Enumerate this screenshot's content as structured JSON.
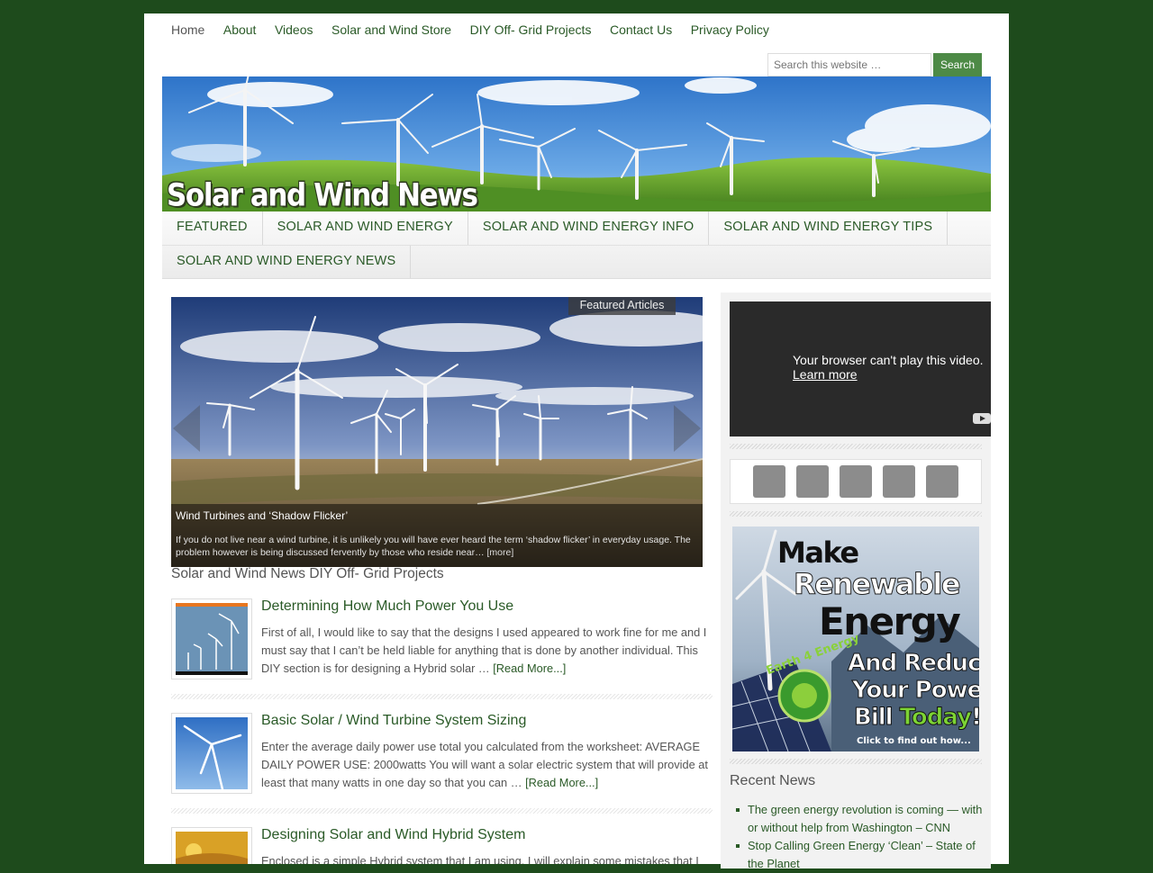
{
  "top_nav": [
    "Home",
    "About",
    "Videos",
    "Solar and Wind Store",
    "DIY Off- Grid Projects",
    "Contact Us",
    "Privacy Policy"
  ],
  "search": {
    "placeholder": "Search this website …",
    "button": "Search"
  },
  "site_title": "Solar and Wind News",
  "category_nav": {
    "row1": [
      "FEATURED",
      "SOLAR AND WIND ENERGY",
      "SOLAR AND WIND ENERGY INFO",
      "SOLAR AND WIND ENERGY TIPS"
    ],
    "row2": [
      "SOLAR AND WIND ENERGY NEWS"
    ]
  },
  "slider": {
    "tag": "Featured Articles",
    "title": "Wind Turbines and ‘Shadow Flicker’",
    "excerpt": "If you do not live near a wind turbine, it is unlikely you will have ever heard the term ‘shadow flicker’ in everyday usage. The problem however is being discussed fervently by those who reside near…",
    "more": "[more]"
  },
  "section_title": "Solar and Wind News DIY Off- Grid Projects",
  "posts": [
    {
      "title": "Determining How Much Power You Use",
      "excerpt": "First of all, I would like to say that the designs I used appeared to work fine for me and I must say that I can’t be held liable for anything that is done by another individual. This DIY section is for designing a Hybrid solar …",
      "read_more": "[Read More...]"
    },
    {
      "title": "Basic Solar / Wind Turbine System Sizing",
      "excerpt": "Enter the average daily power use total you calculated from the worksheet: AVERAGE DAILY POWER USE:   2000watts You will want a solar electric system that will provide at least that many watts in one day so that you can …",
      "read_more": "[Read More...]"
    },
    {
      "title": "Designing Solar and Wind Hybrid System",
      "excerpt": "Enclosed is a simple Hybrid system that I am using. I will explain some mistakes that I",
      "read_more": ""
    }
  ],
  "video": {
    "message": "Your browser can't play this video.",
    "learn_more": "Learn more"
  },
  "social_icons": [
    "social-icon-1",
    "social-icon-2",
    "social-icon-3",
    "social-icon-4",
    "social-icon-5"
  ],
  "ad": {
    "line1": "Make",
    "line2": "Renewable",
    "line3": "Energy",
    "line4": "And Reduce",
    "line5": "Your Power",
    "line6a": "Bill ",
    "line6b": "Today",
    "line6c": "!",
    "cta": "Click to find out how...",
    "badge": "Earth 4 Energy"
  },
  "recent_news": {
    "title": "Recent News",
    "items": [
      "The green energy revolution is coming — with or without help from Washington – CNN",
      "Stop Calling Green Energy ‘Clean’ – State of the Planet"
    ]
  },
  "colors": {
    "page_bg": "#1e4b1c",
    "link": "#2a5a27",
    "search_button": "#4d8a46"
  }
}
